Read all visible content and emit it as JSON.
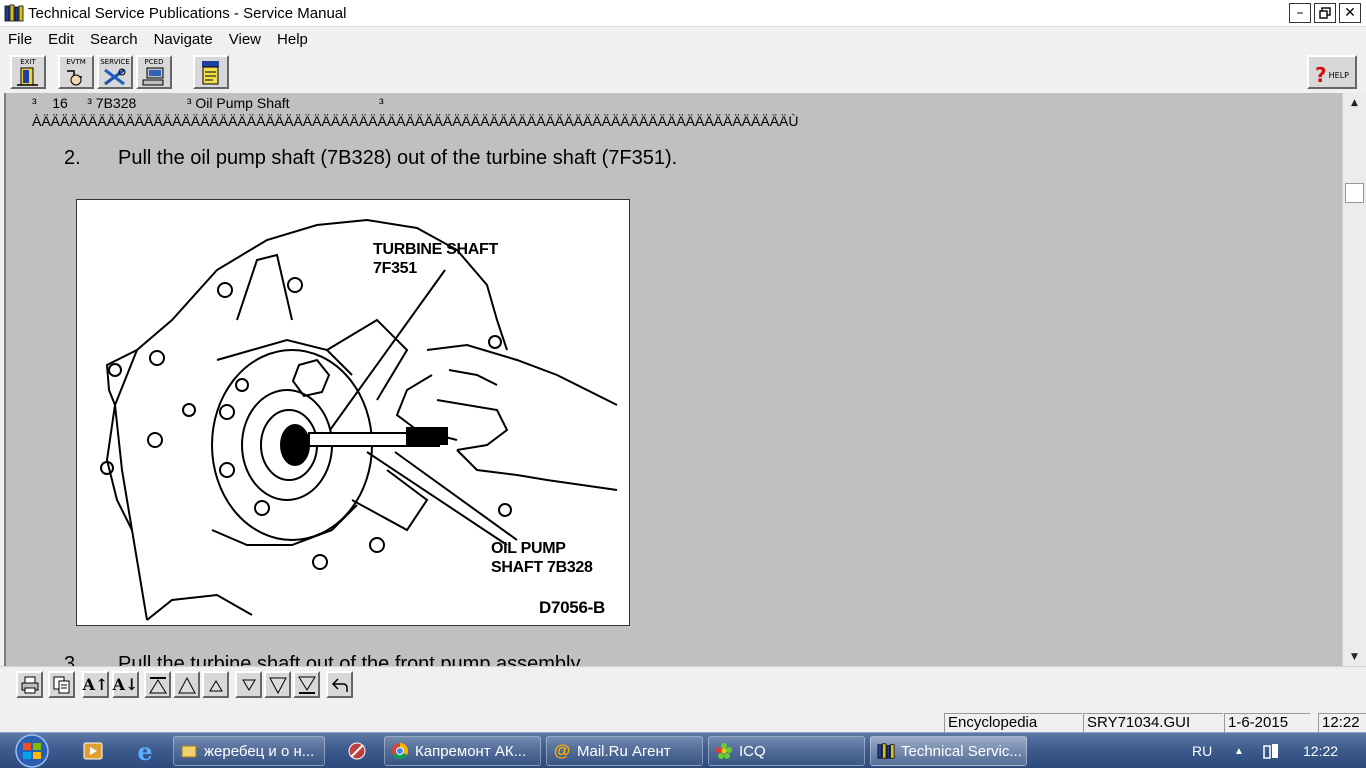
{
  "window": {
    "title": "Technical Service Publications - Service Manual"
  },
  "menu": [
    "File",
    "Edit",
    "Search",
    "Navigate",
    "View",
    "Help"
  ],
  "toolbar": {
    "exit_label": "EXIT",
    "evtm_label": "EVTM",
    "service_label": "SERVICE",
    "pced_label": "PCED",
    "help_label": "HELP"
  },
  "document": {
    "table_row": "³    16     ³ 7B328             ³ Oil Pump Shaft                       ³",
    "table_border": "ÀÄÄÄÄÄÄÄÄÄÄÄÄÄÄÄÄÄÄÄÄÄÄÄÄÄÄÄÄÄÄÄÄÄÄÄÄÄÄÄÄÄÄÄÄÄÄÄÄÄÄÄÄÄÄÄÄÄÄÄÄÄÄÄÄÄÄÄÄÄÄÄÄÄÄÄÄÄÄÄÄÙ",
    "step2_num": "2.",
    "step2_text": "Pull the oil pump shaft (7B328) out of the turbine shaft (7F351).",
    "step3_num": "3.",
    "step3_text": "Pull the turbine shaft out of the front pump assembly.",
    "figure": {
      "callout_turbine_1": "TURBINE SHAFT",
      "callout_turbine_2": "7F351",
      "callout_oil_1": "OIL PUMP",
      "callout_oil_2": "SHAFT 7B328",
      "figure_id": "D7056-B"
    }
  },
  "statusbar": {
    "mode": "Encyclopedia",
    "file": "SRY71034.GUI",
    "date": "1-6-2015",
    "time": "12:22"
  },
  "taskbar": {
    "tasks": [
      {
        "label": "жеребец и о н..."
      },
      {
        "label": "Капремонт АК..."
      },
      {
        "label": "Mail.Ru Агент"
      },
      {
        "label": "ICQ"
      },
      {
        "label": "Technical Servic..."
      }
    ],
    "language": "RU",
    "clock": "12:22"
  }
}
